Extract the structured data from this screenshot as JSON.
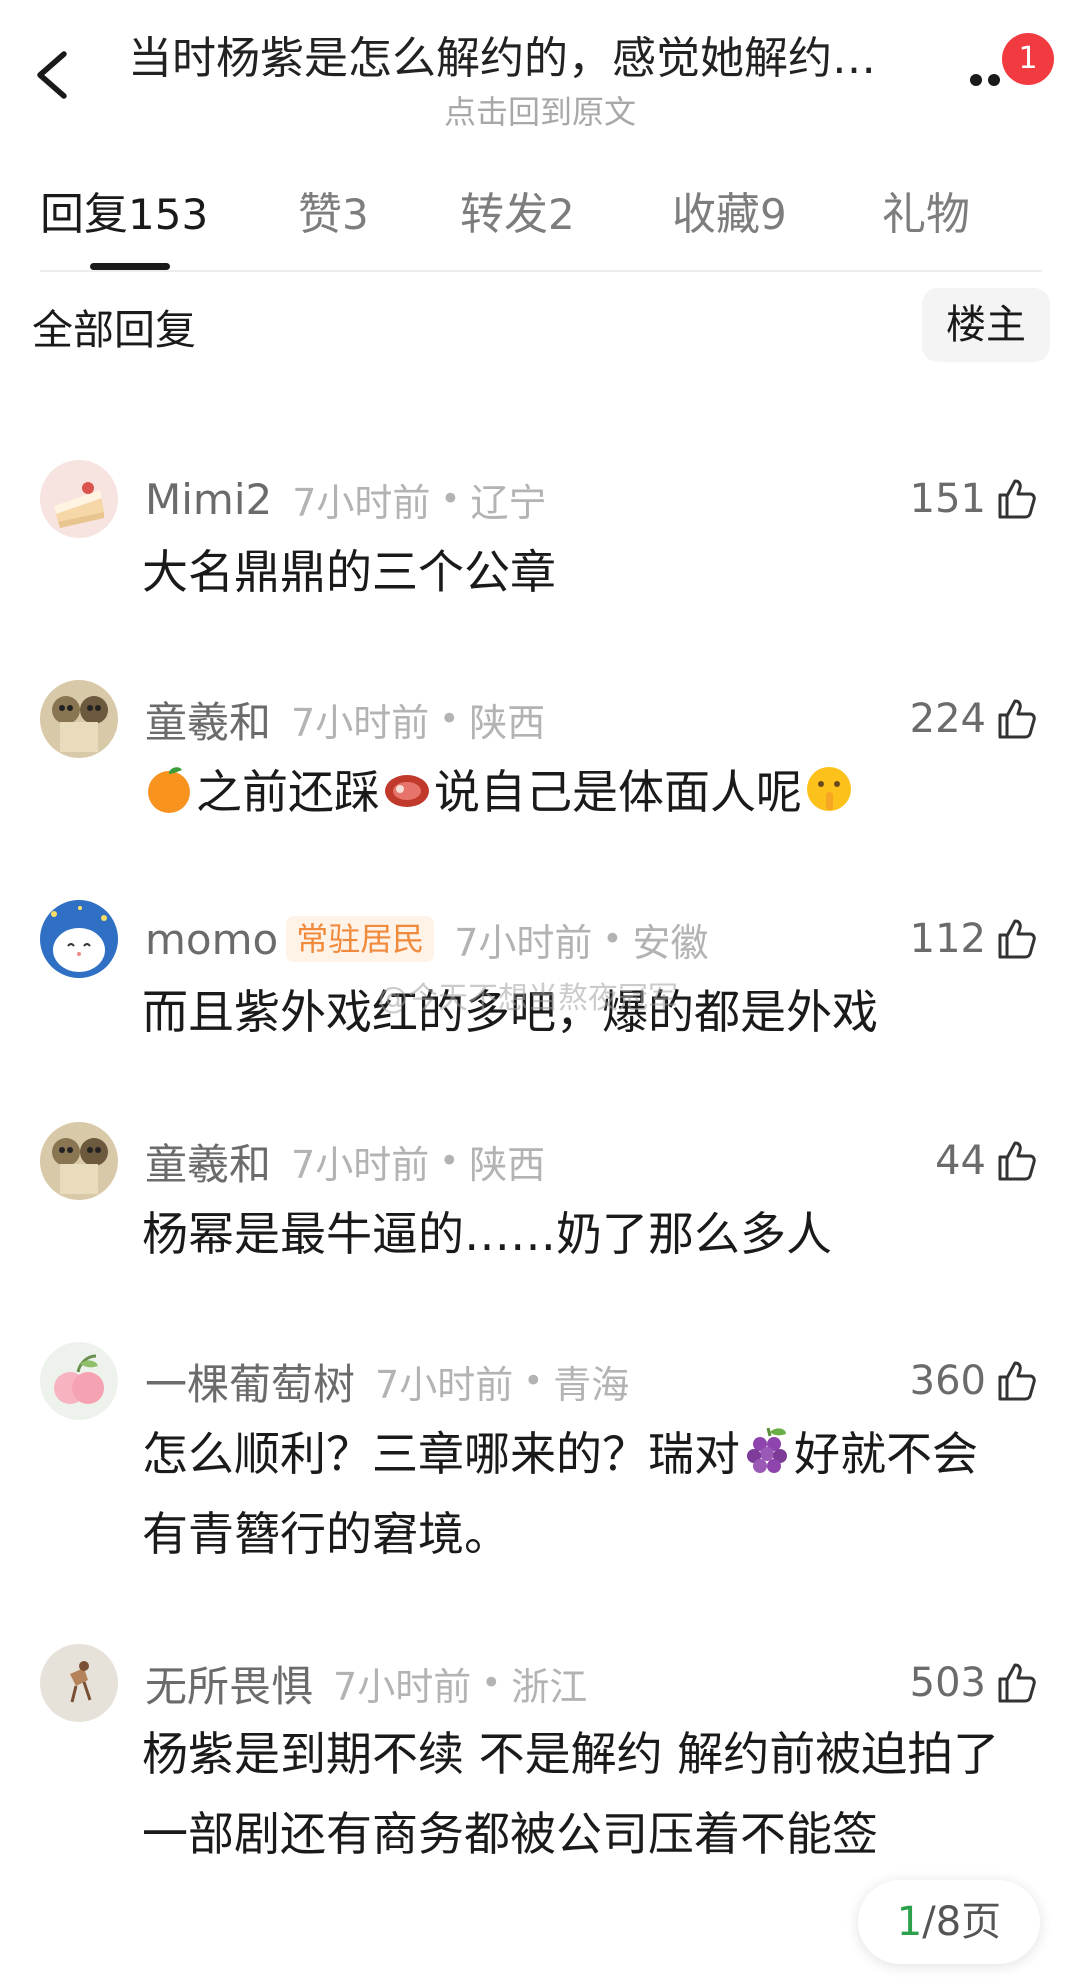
{
  "header": {
    "back_icon": "chevron-left-icon",
    "title": "当时杨紫是怎么解约的，感觉她解约…",
    "subtitle": "点击回到原文",
    "more_icon": "more-dots-icon",
    "badge_count": "1",
    "badge_color": "#f23b41"
  },
  "tabs": [
    {
      "label": "回复",
      "count": "153"
    },
    {
      "label": "赞",
      "count": "3"
    },
    {
      "label": "转发",
      "count": "2"
    },
    {
      "label": "收藏",
      "count": "9"
    },
    {
      "label": "礼物",
      "count": ""
    }
  ],
  "section": {
    "title": "全部回复",
    "filter_label": "楼主"
  },
  "comments": [
    {
      "name": "Mimi2",
      "tag": "",
      "time": "7小时前",
      "location": "辽宁",
      "likes": "151",
      "text": "大名鼎鼎的三个公章"
    },
    {
      "name": "童羲和",
      "tag": "",
      "time": "7小时前",
      "location": "陕西",
      "likes": "224",
      "text_parts": [
        "之前还踩",
        "说自己是体面人呢"
      ],
      "emojis": [
        "orange-emoji",
        "meat-emoji",
        "shush-emoji"
      ]
    },
    {
      "name": "momo",
      "tag": "常驻居民",
      "time": "7小时前",
      "location": "安徽",
      "likes": "112",
      "text": "而且紫外戏红的多吧，爆的都是外戏"
    },
    {
      "name": "童羲和",
      "tag": "",
      "time": "7小时前",
      "location": "陕西",
      "likes": "44",
      "text": "杨幂是最牛逼的……奶了那么多人"
    },
    {
      "name": "一棵葡萄树",
      "tag": "",
      "time": "7小时前",
      "location": "青海",
      "likes": "360",
      "text_parts": [
        "怎么顺利？三章哪来的？瑞对",
        "好就不会有青簪行的窘境。"
      ],
      "emojis": [
        "grape-emoji"
      ]
    },
    {
      "name": "无所畏惧",
      "tag": "",
      "time": "7小时前",
      "location": "浙江",
      "likes": "503",
      "text": "杨紫是到期不续 不是解约  解约前被迫拍了一部剧还有商务都被公司压着不能签"
    }
  ],
  "watermark": "@今天不想当熬夜冠军",
  "pager": {
    "current": "1",
    "total_label": "/8页",
    "current_color": "#2ca04a"
  },
  "dot_separator": "•"
}
